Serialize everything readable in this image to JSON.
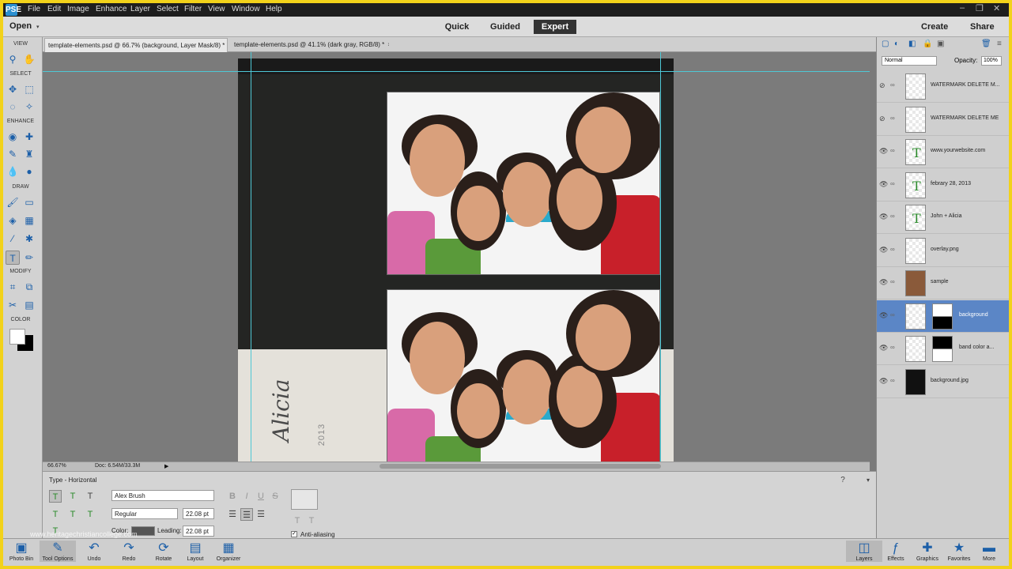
{
  "menubar": {
    "logo": "PSE",
    "items": [
      "File",
      "Edit",
      "Image",
      "Enhance",
      "Layer",
      "Select",
      "Filter",
      "View",
      "Window",
      "Help"
    ],
    "window_controls": [
      "–",
      "❐",
      "✕"
    ]
  },
  "modebar": {
    "open_label": "Open",
    "modes": [
      "Quick",
      "Guided",
      "Expert"
    ],
    "active_mode": "Expert",
    "create_label": "Create",
    "share_label": "Share"
  },
  "toolbox": {
    "sections": [
      "VIEW",
      "SELECT",
      "ENHANCE",
      "DRAW",
      "MODIFY",
      "COLOR"
    ]
  },
  "tabs": [
    {
      "title": "template-elements.psd @ 66.7% (background, Layer Mask/8) *",
      "close": "×"
    },
    {
      "title": "template-elements.psd @ 41.1% (dark gray, RGB/8) *",
      "close": "×"
    }
  ],
  "canvas": {
    "vertical_name": "Alicia",
    "vertical_year": "2013"
  },
  "statusbar": {
    "zoom": "66.67%",
    "doc": "Doc: 6.54M/33.3M"
  },
  "options": {
    "tool_label": "Type - Horizontal",
    "font_family": "Alex Brush",
    "font_style": "Regular",
    "font_size": "22.08 pt",
    "color_label": "Color:",
    "leading_label": "Leading:",
    "leading_value": "22.08 pt",
    "antialias_label": "Anti-aliasing",
    "style_buttons": [
      "B",
      "I",
      "U",
      "S"
    ]
  },
  "layers_panel": {
    "blend_mode": "Normal",
    "opacity_label": "Opacity:",
    "opacity_value": "100%",
    "layers": [
      {
        "name": "WATERMARK DELETE M...",
        "kind": "raster",
        "selected": false
      },
      {
        "name": "WATERMARK DELETE ME",
        "kind": "raster",
        "selected": false
      },
      {
        "name": "www.yourwebsite.com",
        "kind": "text",
        "selected": false
      },
      {
        "name": "febrary 28, 2013",
        "kind": "text",
        "selected": false
      },
      {
        "name": "John + Alicia",
        "kind": "text",
        "selected": false
      },
      {
        "name": "overlay.png",
        "kind": "raster",
        "selected": false
      },
      {
        "name": "sample",
        "kind": "raster",
        "selected": false
      },
      {
        "name": "background",
        "kind": "masked",
        "selected": true
      },
      {
        "name": "band color a...",
        "kind": "masked",
        "selected": false
      },
      {
        "name": "background.jpg",
        "kind": "raster",
        "selected": false
      }
    ]
  },
  "bottombar": {
    "left": [
      {
        "label": "Photo Bin",
        "icon": "photo-bin-icon"
      },
      {
        "label": "Tool Options",
        "icon": "tool-options-icon"
      },
      {
        "label": "Undo",
        "icon": "undo-icon"
      },
      {
        "label": "Redo",
        "icon": "redo-icon"
      },
      {
        "label": "Rotate",
        "icon": "rotate-icon"
      },
      {
        "label": "Layout",
        "icon": "layout-icon"
      },
      {
        "label": "Organizer",
        "icon": "organizer-icon"
      }
    ],
    "right": [
      {
        "label": "Layers",
        "icon": "layers-icon"
      },
      {
        "label": "Effects",
        "icon": "effects-icon"
      },
      {
        "label": "Graphics",
        "icon": "graphics-icon"
      },
      {
        "label": "Favorites",
        "icon": "favorites-icon"
      },
      {
        "label": "More",
        "icon": "more-icon"
      }
    ]
  },
  "watermark": "www.heritagechristiancollege.com"
}
